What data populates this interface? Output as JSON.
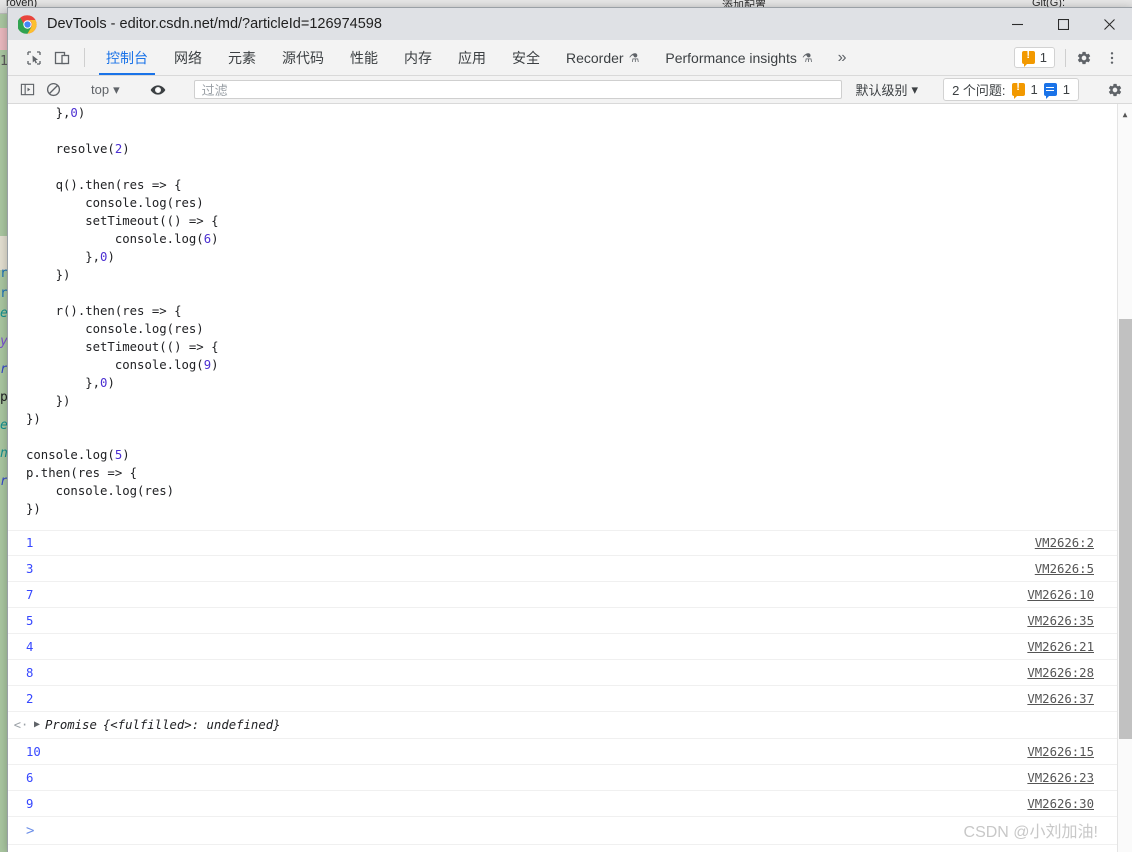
{
  "background_ide": {
    "project_label": "roven)",
    "run_config_label": "添加配置...",
    "git_label": "Git(G):",
    "left_fragments": [
      "1",
      "r:",
      "r:",
      "e",
      "y",
      "r",
      "p.",
      "e",
      "ng",
      "r"
    ]
  },
  "window": {
    "title": "DevTools - editor.csdn.net/md/?articleId=126974598",
    "controls": {
      "minimize": "minimize-button",
      "maximize": "maximize-button",
      "close": "close-button"
    }
  },
  "tabstrip": {
    "inspect_icon": "inspect-element-icon",
    "device_icon": "toggle-device-toolbar-icon",
    "tabs": [
      {
        "label": "控制台",
        "active": true,
        "beaker": false
      },
      {
        "label": "网络",
        "active": false,
        "beaker": false
      },
      {
        "label": "元素",
        "active": false,
        "beaker": false
      },
      {
        "label": "源代码",
        "active": false,
        "beaker": false
      },
      {
        "label": "性能",
        "active": false,
        "beaker": false
      },
      {
        "label": "内存",
        "active": false,
        "beaker": false
      },
      {
        "label": "应用",
        "active": false,
        "beaker": false
      },
      {
        "label": "安全",
        "active": false,
        "beaker": false
      },
      {
        "label": "Recorder",
        "active": false,
        "beaker": true
      },
      {
        "label": "Performance insights",
        "active": false,
        "beaker": true
      }
    ],
    "more_label": "»",
    "warning_count": "1",
    "settings_icon": "gear-icon",
    "menu_icon": "more-vertical-icon"
  },
  "consolebar": {
    "sidebar_icon": "console-sidebar-icon",
    "clear_icon": "clear-console-icon",
    "context": "top",
    "eye_icon": "live-expression-eye-icon",
    "filter_placeholder": "过滤",
    "filter_value": "",
    "level": "默认级别",
    "issues_label": "2 个问题:",
    "issues_warning_count": "1",
    "issues_info_count": "1",
    "settings_icon": "console-settings-gear-icon"
  },
  "console": {
    "code": "    },0)\n\n    resolve(2)\n\n    q().then(res => {\n        console.log(res)\n        setTimeout(() => {\n            console.log(6)\n        },0)\n    })\n\n    r().then(res => {\n        console.log(res)\n        setTimeout(() => {\n            console.log(9)\n        },0)\n    })\n})\n\nconsole.log(5)\np.then(res => {\n    console.log(res)\n})",
    "logs_before_result": [
      {
        "value": "1",
        "source": "VM2626:2"
      },
      {
        "value": "3",
        "source": "VM2626:5"
      },
      {
        "value": "7",
        "source": "VM2626:10"
      },
      {
        "value": "5",
        "source": "VM2626:35"
      },
      {
        "value": "4",
        "source": "VM2626:21"
      },
      {
        "value": "8",
        "source": "VM2626:28"
      },
      {
        "value": "2",
        "source": "VM2626:37"
      }
    ],
    "result": {
      "arrow": "<·",
      "disclosure": "▶",
      "type": "Promise",
      "body": "{<fulfilled>: undefined}"
    },
    "logs_after_result": [
      {
        "value": "10",
        "source": "VM2626:15"
      },
      {
        "value": "6",
        "source": "VM2626:23"
      },
      {
        "value": "9",
        "source": "VM2626:30"
      }
    ],
    "prompt": ">"
  },
  "watermark": "CSDN @小刘加油!",
  "colors": {
    "accent_blue": "#1a73e8",
    "log_value_blue": "#3647ff",
    "warning_orange": "#f29900",
    "info_blue": "#1a73e8",
    "code_number_purple": "#4b2fd1"
  }
}
